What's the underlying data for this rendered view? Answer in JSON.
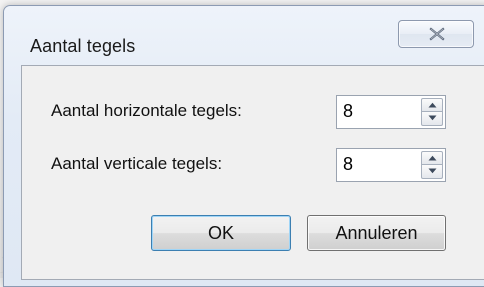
{
  "dialog": {
    "title": "Aantal tegels",
    "close_glyph": "✕"
  },
  "fields": [
    {
      "label": "Aantal horizontale tegels:",
      "value": "8"
    },
    {
      "label": "Aantal verticale tegels:",
      "value": "8"
    }
  ],
  "buttons": {
    "ok_label": "OK",
    "cancel_label": "Annuleren"
  },
  "icons": {
    "close": "close-icon",
    "spin_up": "spin-up-arrow-icon",
    "spin_down": "spin-down-arrow-icon"
  },
  "colors": {
    "titlebar_bg": "#e3ebf6",
    "client_bg": "#f0f0f0",
    "default_button_border": "#3c7fb1"
  }
}
